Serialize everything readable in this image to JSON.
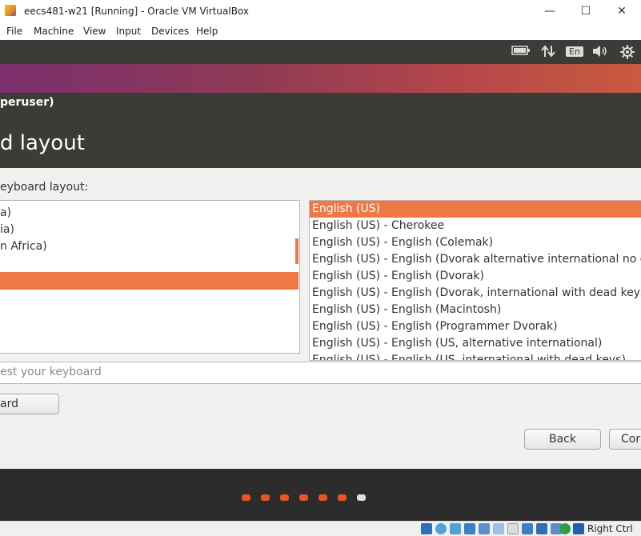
{
  "window": {
    "title": "eecs481-w21 [Running] - Oracle VM VirtualBox",
    "minimize": "—",
    "maximize": "☐",
    "close": "✕"
  },
  "menu": [
    "File",
    "Machine",
    "View",
    "Input",
    "Devices",
    "Help"
  ],
  "panel": {
    "keyboard_indicator": "En",
    "volume_icon": "speaker-icon",
    "network_icon": "network-arrows-icon",
    "battery_icon": "battery-icon",
    "settings_icon": "gear-icon"
  },
  "dialog": {
    "title_fragment": "peruser)",
    "heading_fragment": "d layout",
    "choose_label_fragment": "eyboard layout:",
    "left_list": [
      "a)",
      "ia)",
      "n Africa)"
    ],
    "right_list": [
      "English (US)",
      "English (US) - Cherokee",
      "English (US) - English (Colemak)",
      "English (US) - English (Dvorak alternative international no de",
      "English (US) - English (Dvorak)",
      "English (US) - English (Dvorak, international with dead keys)",
      "English (US) - English (Macintosh)",
      "English (US) - English (Programmer Dvorak)",
      "English (US) - English (US, alternative international)",
      "English (US) - English (US, international with dead keys)"
    ],
    "test_placeholder_fragment": "est your keyboard",
    "detect_button_fragment": "ard Layout",
    "back_button": "Back",
    "continue_button_fragment": "Cor"
  },
  "progress": {
    "total_steps": 7,
    "current_step": 7
  },
  "statusbar": {
    "host_key": "Right Ctrl"
  },
  "colors": {
    "accent": "#f07746",
    "ubuntu_orange": "#e95420",
    "panel": "#3c3b37"
  }
}
